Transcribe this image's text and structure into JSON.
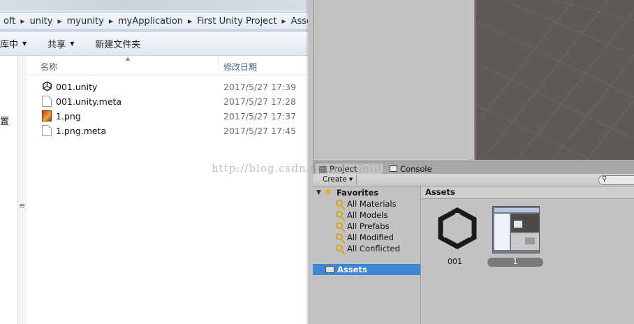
{
  "explorer": {
    "breadcrumb": [
      "oft",
      "unity",
      "myunity",
      "myApplication",
      "First Unity Project",
      "Assets"
    ],
    "toolbar": {
      "include_in_library": "库中",
      "share": "共享",
      "new_folder": "新建文件夹"
    },
    "nav_partial_label": "置",
    "columns": {
      "name": "名称",
      "date_modified": "修改日期"
    },
    "files": [
      {
        "name": "001.unity",
        "date": "2017/5/27 17:39",
        "icon": "unity-icon"
      },
      {
        "name": "001.unity.meta",
        "date": "2017/5/27 17:28",
        "icon": "file-icon"
      },
      {
        "name": "1.png",
        "date": "2017/5/27 17:37",
        "icon": "image-icon"
      },
      {
        "name": "1.png.meta",
        "date": "2017/5/27 17:45",
        "icon": "file-icon"
      }
    ]
  },
  "unity": {
    "tabs": {
      "project": "Project",
      "console": "Console"
    },
    "create_label": "Create",
    "favorites": {
      "header": "Favorites",
      "items": [
        "All Materials",
        "All Models",
        "All Prefabs",
        "All Modified",
        "All Conflicted"
      ]
    },
    "tree_assets": "Assets",
    "grid_header": "Assets",
    "assets": [
      {
        "label": "001",
        "icon": "unity-logo-icon"
      },
      {
        "label": "1",
        "icon": "image-thumbnail"
      }
    ],
    "colors": {
      "selection": "#3d87d6",
      "panel": "#c2c2c2",
      "scene": "#5f5a57"
    }
  },
  "watermark": "http://blog.csdn.net/nicolelili"
}
